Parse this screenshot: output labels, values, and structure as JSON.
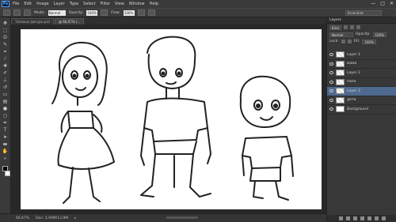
{
  "menu": {
    "logo": "Ps",
    "items": [
      "File",
      "Edit",
      "Image",
      "Layer",
      "Type",
      "Select",
      "Filter",
      "View",
      "Window",
      "Help"
    ]
  },
  "window_controls": {
    "minimize": "—",
    "maximize": "□",
    "close": "✕"
  },
  "options": {
    "brush_label": "Brush",
    "mode_label": "Mode:",
    "mode_value": "Normal",
    "opacity_label": "Opacity:",
    "opacity_value": "100%",
    "flow_label": "Flow:",
    "flow_value": "100%",
    "workspace": "Essentials"
  },
  "doc_tabs": [
    {
      "label": "Типовые фигуры.psd",
      "active": false
    },
    {
      "label": "@ 66,67% (...",
      "active": true
    }
  ],
  "status": {
    "zoom": "66,67%",
    "doc_info": "Doc: 2,99M/12,9M"
  },
  "layers_panel": {
    "title": "Layers",
    "kind_label": "Kind",
    "blend_mode": "Normal",
    "opacity_label": "Opacity:",
    "opacity_value": "100%",
    "lock_label": "Lock:",
    "fill_label": "Fill:",
    "fill_value": "100%",
    "layers": [
      {
        "name": "Layer 1",
        "active": false,
        "thumb": "checker"
      },
      {
        "name": "мама",
        "active": false,
        "thumb": "checker"
      },
      {
        "name": "Layer 2",
        "active": false,
        "thumb": "checker"
      },
      {
        "name": "папа",
        "active": false,
        "thumb": "checker"
      },
      {
        "name": "Layer 3",
        "active": true,
        "thumb": "checker"
      },
      {
        "name": "дети",
        "active": false,
        "thumb": "checker"
      },
      {
        "name": "Background",
        "active": false,
        "thumb": "white"
      }
    ]
  },
  "colors": {
    "accent": "#4e6a8f",
    "panel": "#383838",
    "canvas": "#ffffff"
  }
}
